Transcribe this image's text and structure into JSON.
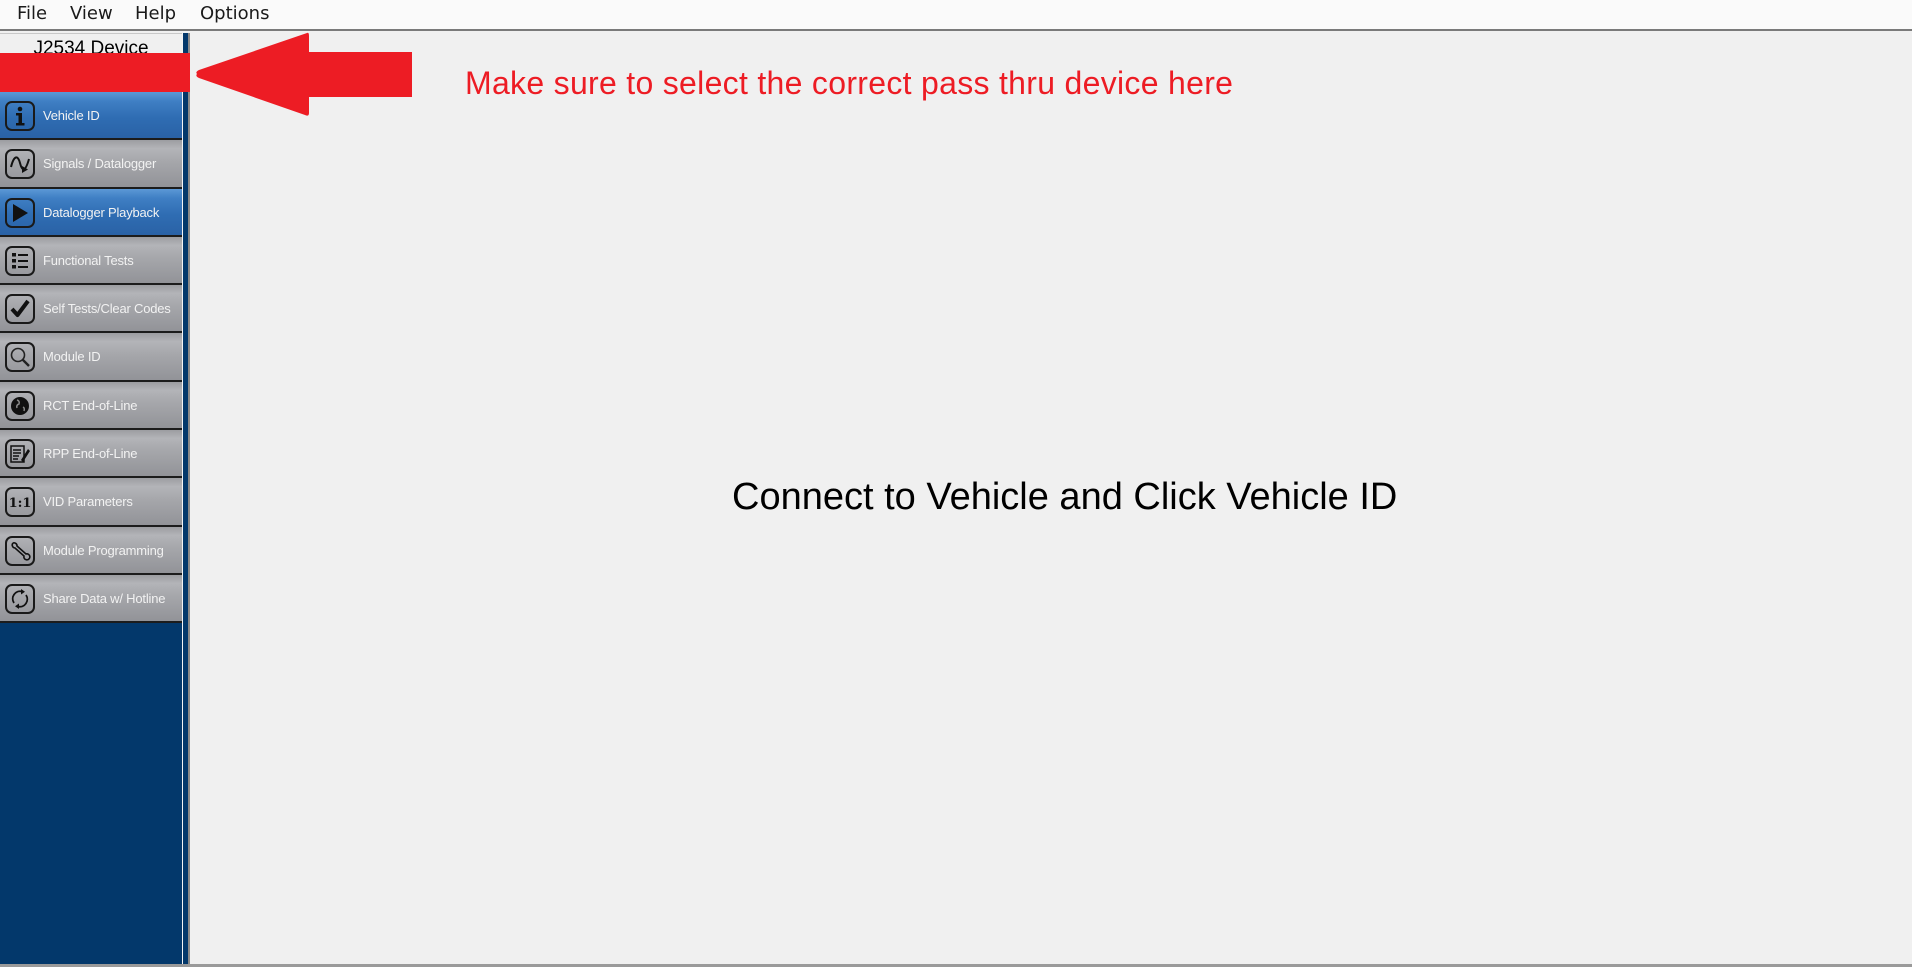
{
  "menubar": {
    "items": [
      "File",
      "View",
      "Help",
      "Options"
    ]
  },
  "sidebar": {
    "device_label": "J2534 Device",
    "device_selected": "",
    "items": [
      {
        "label": "Vehicle ID",
        "icon": "info-icon",
        "style": "blue"
      },
      {
        "label": "Signals / Datalogger",
        "icon": "signal-icon",
        "style": "gray"
      },
      {
        "label": "Datalogger Playback",
        "icon": "play-icon",
        "style": "blue"
      },
      {
        "label": "Functional Tests",
        "icon": "list-icon",
        "style": "gray"
      },
      {
        "label": "Self Tests/Clear Codes",
        "icon": "checkmark-icon",
        "style": "gray"
      },
      {
        "label": "Module ID",
        "icon": "magnifier-icon",
        "style": "gray"
      },
      {
        "label": "RCT End-of-Line",
        "icon": "globe-icon",
        "style": "gray"
      },
      {
        "label": "RPP End-of-Line",
        "icon": "document-edit-icon",
        "style": "gray"
      },
      {
        "label": "VID Parameters",
        "icon": "ratio-icon",
        "style": "gray"
      },
      {
        "label": "Module Programming",
        "icon": "wrench-icon",
        "style": "gray"
      },
      {
        "label": "Share Data w/ Hotline",
        "icon": "refresh-icon",
        "style": "gray"
      }
    ]
  },
  "content": {
    "message": "Connect to Vehicle and Click Vehicle ID"
  },
  "annotation": {
    "text": "Make sure to select the correct pass thru device here",
    "color": "#ed1c24"
  },
  "colors": {
    "sidebar_bg": "#03386b",
    "item_blue": "#2f6db3",
    "item_gray": "#a6a7ab"
  }
}
